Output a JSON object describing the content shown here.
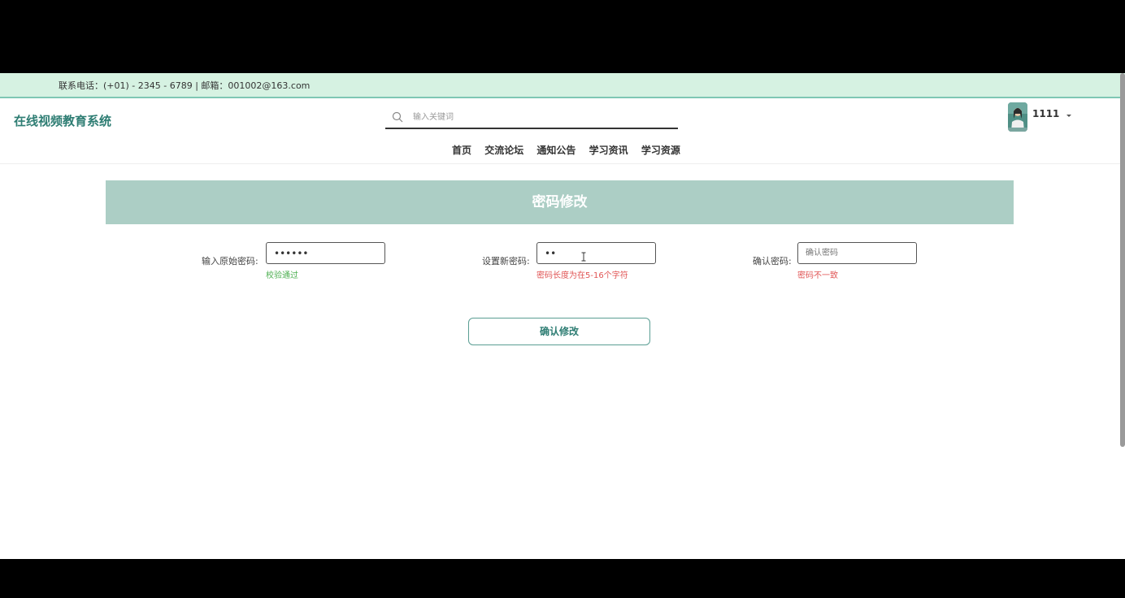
{
  "topbar": {
    "contact": "联系电话：(+01) - 2345 - 6789 | 邮箱：001002@163.com"
  },
  "header": {
    "brand": "在线视频教育系统",
    "search": {
      "placeholder": "输入关键词",
      "icon": "search-icon"
    },
    "user": {
      "name": "1111",
      "icon": "chevron-down-icon"
    },
    "nav": [
      "首页",
      "交流论坛",
      "通知公告",
      "学习资讯",
      "学习资源"
    ]
  },
  "page": {
    "title": "密码修改"
  },
  "form": {
    "old_password": {
      "label": "输入原始密码:",
      "value": "••••••",
      "hint": "校验通过"
    },
    "new_password": {
      "label": "设置新密码:",
      "value": "••",
      "hint": "密码长度为在5-16个字符"
    },
    "confirm_password": {
      "label": "确认密码:",
      "placeholder": "确认密码",
      "hint": "密码不一致"
    },
    "submit_label": "确认修改"
  },
  "colors": {
    "accent": "#2e7d73",
    "banner": "#accec5",
    "topbar": "#d6f2e2",
    "ok": "#4caf50",
    "error": "#e05454"
  }
}
